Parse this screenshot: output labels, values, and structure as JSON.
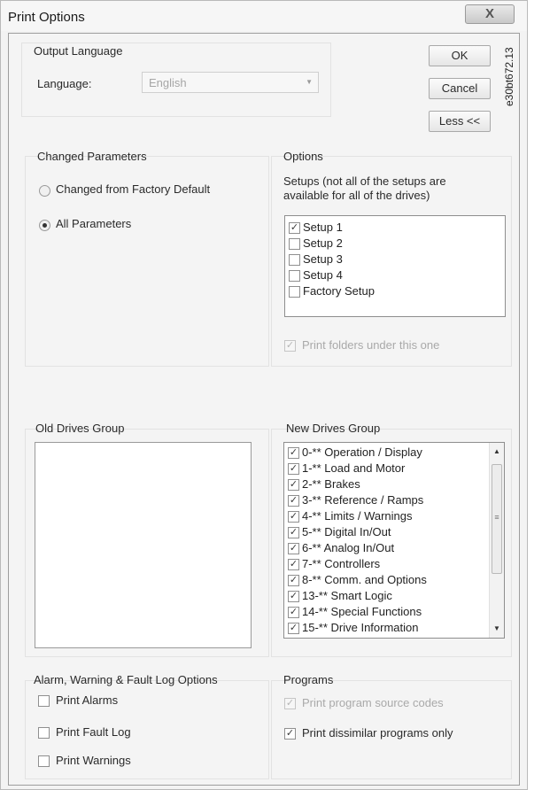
{
  "window": {
    "title": "Print Options",
    "close_label": "X"
  },
  "side_label": "e30bt672.13",
  "buttons": {
    "ok": "OK",
    "cancel": "Cancel",
    "less": "Less <<"
  },
  "output_language": {
    "title": "Output Language",
    "language_label": "Language:",
    "language_value": "English"
  },
  "changed_parameters": {
    "title": "Changed Parameters",
    "options": [
      {
        "label": "Changed from Factory Default",
        "selected": false
      },
      {
        "label": "All Parameters",
        "selected": true
      }
    ]
  },
  "options": {
    "title": "Options",
    "setups_desc_line1": "Setups (not all of the setups are",
    "setups_desc_line2": "available for all of the drives)",
    "setups": [
      {
        "label": "Setup 1",
        "checked": true
      },
      {
        "label": "Setup 2",
        "checked": false
      },
      {
        "label": "Setup 3",
        "checked": false
      },
      {
        "label": "Setup 4",
        "checked": false
      },
      {
        "label": "Factory Setup",
        "checked": false
      }
    ],
    "print_folders": {
      "label": "Print folders under this one",
      "checked": true,
      "enabled": false
    }
  },
  "old_drives": {
    "title": "Old Drives Group"
  },
  "new_drives": {
    "title": "New Drives Group",
    "items": [
      {
        "label": "0-** Operation / Display",
        "checked": true
      },
      {
        "label": "1-** Load and Motor",
        "checked": true
      },
      {
        "label": "2-** Brakes",
        "checked": true
      },
      {
        "label": "3-** Reference / Ramps",
        "checked": true
      },
      {
        "label": "4-** Limits / Warnings",
        "checked": true
      },
      {
        "label": "5-** Digital In/Out",
        "checked": true
      },
      {
        "label": "6-** Analog In/Out",
        "checked": true
      },
      {
        "label": "7-** Controllers",
        "checked": true
      },
      {
        "label": "8-** Comm. and Options",
        "checked": true
      },
      {
        "label": "13-** Smart Logic",
        "checked": true
      },
      {
        "label": "14-** Special Functions",
        "checked": true
      },
      {
        "label": "15-** Drive Information",
        "checked": true
      }
    ]
  },
  "alarm_log": {
    "title": "Alarm, Warning & Fault Log Options",
    "items": [
      {
        "label": "Print Alarms",
        "checked": false
      },
      {
        "label": "Print Fault Log",
        "checked": false
      },
      {
        "label": "Print Warnings",
        "checked": false
      }
    ]
  },
  "programs": {
    "title": "Programs",
    "items": [
      {
        "label": "Print program source codes",
        "checked": true,
        "enabled": false
      },
      {
        "label": "Print dissimilar programs only",
        "checked": true,
        "enabled": true
      }
    ]
  }
}
